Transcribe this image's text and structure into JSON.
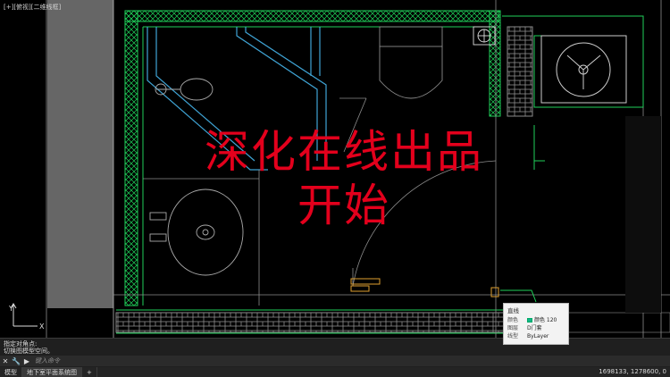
{
  "viewport": {
    "label": "[+][俯视][二维线框]"
  },
  "overlay": {
    "line1": "深化在线出品",
    "line2": "开始"
  },
  "tooltip": {
    "title": "直线",
    "rows": [
      {
        "key": "颜色",
        "value": "颜色 120",
        "swatch": "#10b58b"
      },
      {
        "key": "图层",
        "value": "D门套"
      },
      {
        "key": "线型",
        "value": "ByLayer"
      }
    ]
  },
  "command": {
    "history_line1": "指定对角点:",
    "history_line2": "切换图模型空间。",
    "input_placeholder": "键入命令"
  },
  "status": {
    "tabs": [
      {
        "label": "模型",
        "active": false
      },
      {
        "label": "地下室平面系统图",
        "active": true
      },
      {
        "label": "+",
        "active": false
      }
    ],
    "coords": "1698133, 1278600, 0"
  },
  "colors": {
    "background": "#000000",
    "wall_green": "#1fd15a",
    "cyan": "#3fa3d4",
    "grey": "#8c8c8c",
    "overlay_red": "#e3001c",
    "orange": "#e0a030"
  }
}
